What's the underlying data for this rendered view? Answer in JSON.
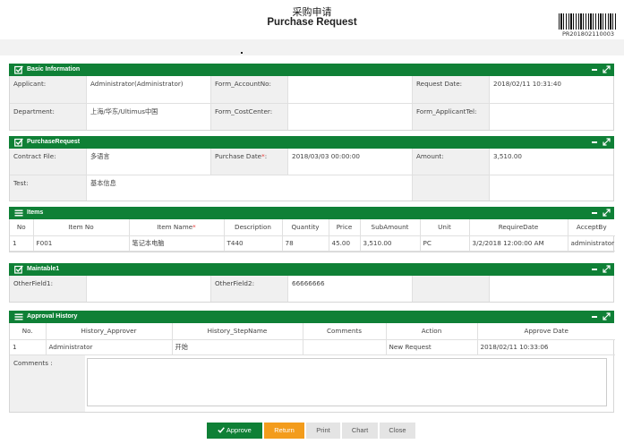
{
  "header": {
    "title_cn": "采购申请",
    "title_en": "Purchase Request",
    "doc_number": "PR201802110003"
  },
  "colors": {
    "panel_green": "#0f8036",
    "return_orange": "#f39c1c"
  },
  "basic_info": {
    "title": "Basic Information",
    "applicant_label": "Applicant:",
    "applicant_value": "Administrator(Administrator)",
    "account_label": "Form_AccountNo:",
    "account_value": "",
    "request_date_label": "Request Date:",
    "request_date_value": "2018/02/11 10:31:40",
    "department_label": "Department:",
    "department_value": "上海/华东/Ultimus中国",
    "costcenter_label": "Form_CostCenter:",
    "costcenter_value": "",
    "tel_label": "Form_ApplicantTel:",
    "tel_value": ""
  },
  "purchase_request": {
    "title": "PurchaseRequest",
    "contract_label": "Contract File:",
    "contract_value": "多语言",
    "purchase_date_label": "Purchase Date",
    "purchase_date_req": "*",
    "purchase_date_colon": ":",
    "purchase_date_value": "2018/03/03 00:00:00",
    "amount_label": "Amount:",
    "amount_value": "3,510.00",
    "test_label": "Test:",
    "test_value": "基本信息"
  },
  "items": {
    "title": "Items",
    "headers": {
      "no": "No",
      "item_no": "Item No",
      "item_name": "Item Name",
      "item_name_req": "*",
      "description": "Description",
      "quantity": "Quantity",
      "price": "Price",
      "subamount": "SubAmount",
      "unit": "Unit",
      "require_date": "RequireDate",
      "accept_by": "AcceptBy"
    },
    "rows": [
      {
        "no": "1",
        "item_no": "F001",
        "item_name": "笔记本电脑",
        "description": "T440",
        "quantity": "78",
        "price": "45.00",
        "subamount": "3,510.00",
        "unit": "PC",
        "require_date": "3/2/2018 12:00:00 AM",
        "accept_by": "administrator"
      }
    ]
  },
  "maintable1": {
    "title": "Maintable1",
    "other1_label": "OtherField1:",
    "other1_value": "",
    "other2_label": "OtherField2:",
    "other2_value": "66666666"
  },
  "approval_history": {
    "title": "Approval History",
    "headers": {
      "no": "No.",
      "approver": "History_Approver",
      "step": "History_StepName",
      "comments": "Comments",
      "action": "Action",
      "date": "Approve Date"
    },
    "rows": [
      {
        "no": "1",
        "approver": "Administrator",
        "step": "开始",
        "comments": "",
        "action": "New Request",
        "date": "2018/02/11 10:33:06"
      }
    ],
    "comments_label": "Comments :",
    "comments_value": ""
  },
  "buttons": {
    "approve": "Approve",
    "return": "Return",
    "print": "Print",
    "chart": "Chart",
    "close": "Close"
  },
  "icons": {
    "checkbox": "checkbox-icon",
    "list": "list-icon",
    "minimize": "minimize-icon",
    "maximize": "expand-icon",
    "check": "check-icon"
  }
}
